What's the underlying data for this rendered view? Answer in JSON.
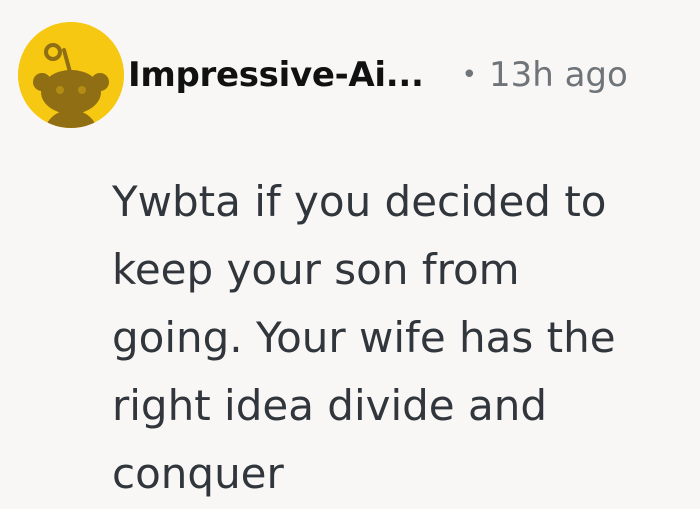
{
  "comment": {
    "author": "Impressive-Ai...",
    "separator": "•",
    "time_ago": "13h ago",
    "avatar_icon": "snoo-avatar-icon",
    "avatar_color": "#f6c812",
    "body_lines": [
      "Ywbta if you decided to",
      "keep your son from",
      "going. Your wife has the",
      "right idea divide and",
      "conquer"
    ]
  }
}
